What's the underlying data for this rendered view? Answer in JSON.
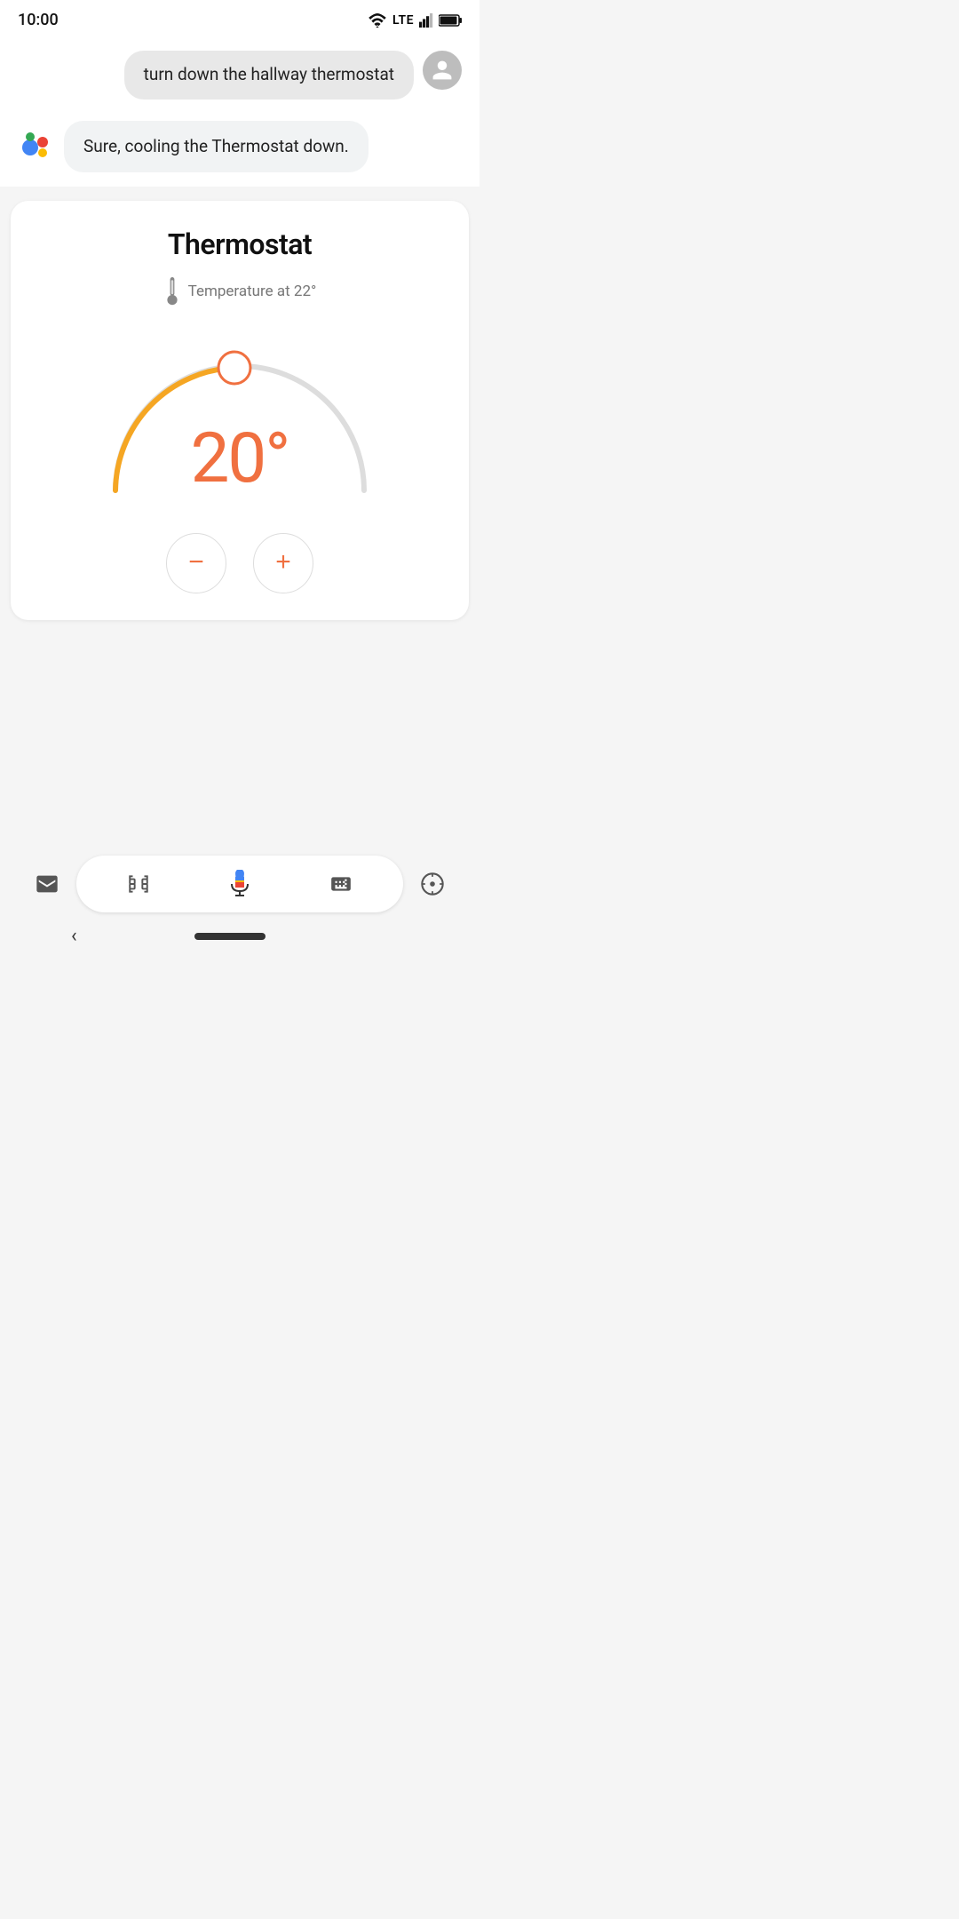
{
  "statusBar": {
    "time": "10:00",
    "wifi": "wifi-icon",
    "lte": "LTE",
    "signal": "signal-icon",
    "battery": "battery-icon"
  },
  "chat": {
    "userMessage": "turn down the hallway thermostat",
    "assistantMessage": "Sure, cooling the Thermostat down."
  },
  "thermostat": {
    "title": "Thermostat",
    "tempLabel": "Temperature at 22°",
    "currentTemp": "20°",
    "minTemp": 10,
    "maxTemp": 35,
    "currentValue": 20,
    "arcPercent": 0.42
  },
  "controls": {
    "decreaseLabel": "−",
    "increaseLabel": "+"
  },
  "bottomBar": {
    "leftIcon": "assistant-icon",
    "cameraIcon": "camera-scan-icon",
    "micIcon": "mic-icon",
    "keyboardIcon": "keyboard-icon",
    "rightIcon": "compass-icon"
  }
}
